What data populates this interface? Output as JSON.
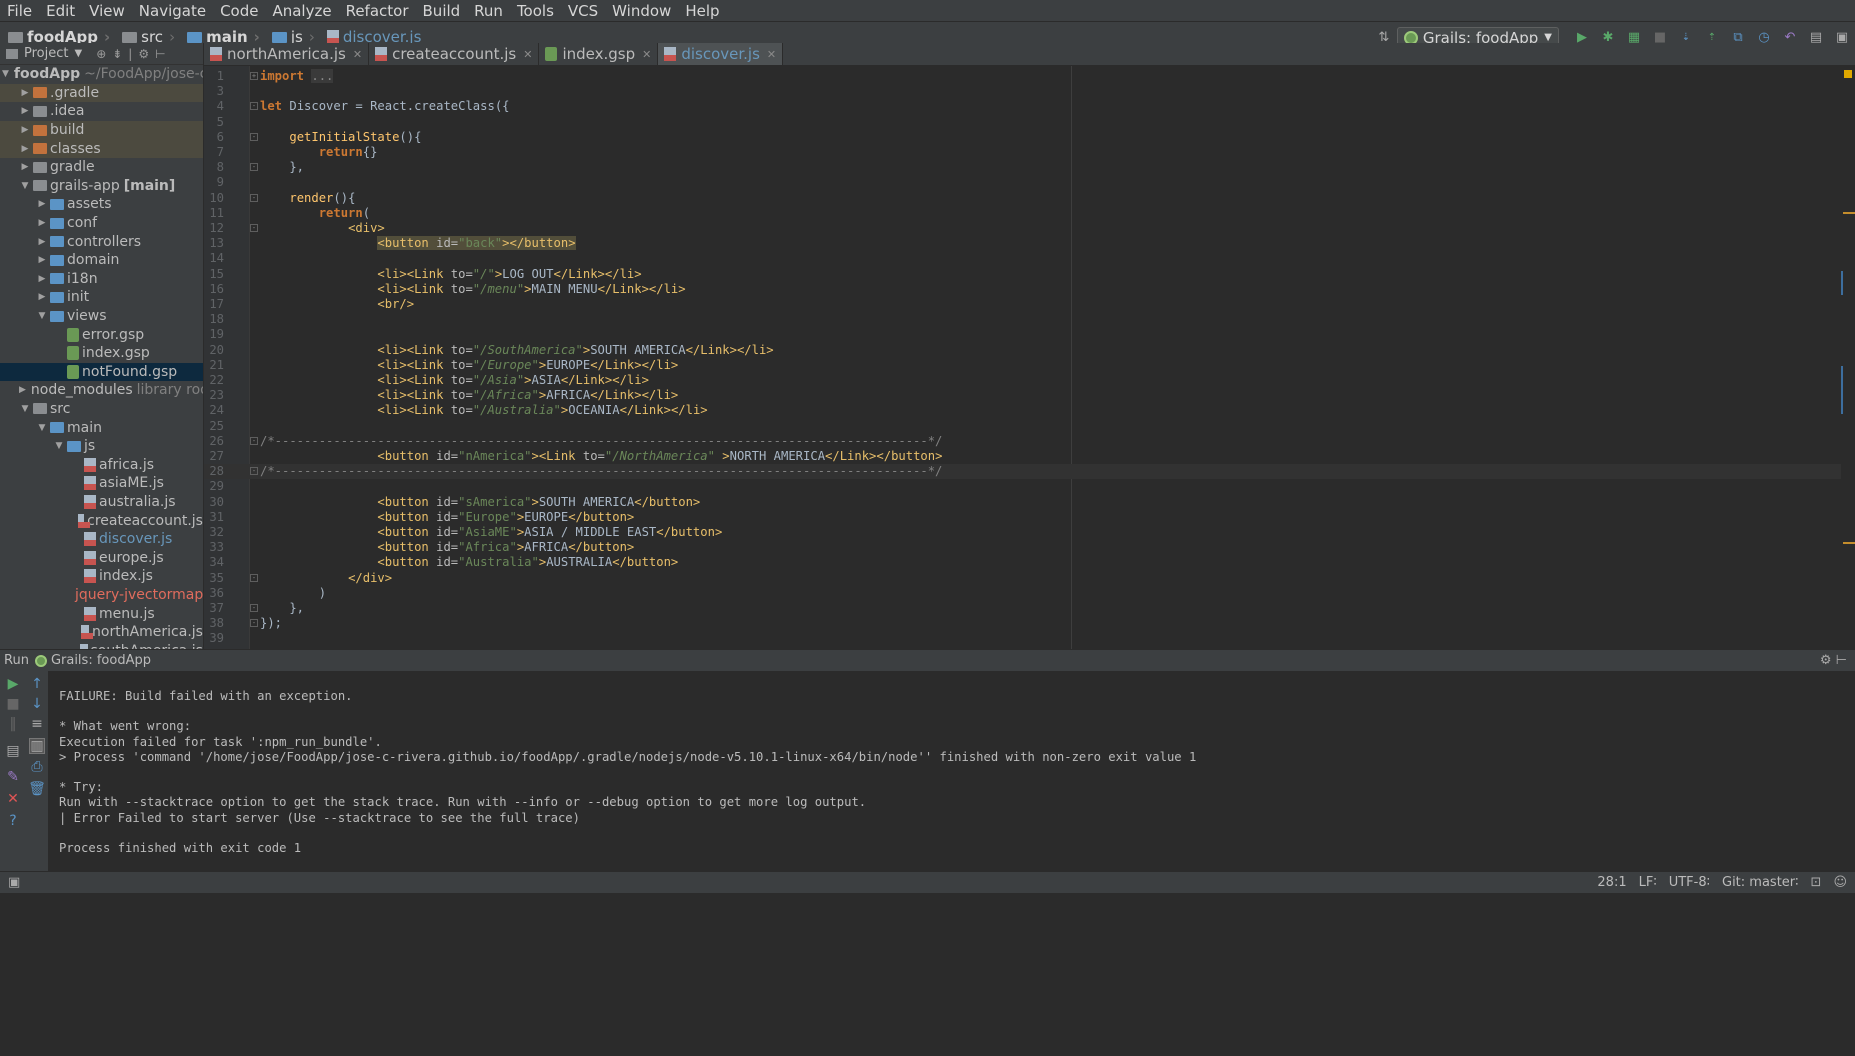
{
  "menu": [
    "File",
    "Edit",
    "View",
    "Navigate",
    "Code",
    "Analyze",
    "Refactor",
    "Build",
    "Run",
    "Tools",
    "VCS",
    "Window",
    "Help"
  ],
  "breadcrumbs": [
    "foodApp",
    "src",
    "main",
    "js",
    "discover.js"
  ],
  "run_config": "Grails: foodApp",
  "project_panel": {
    "title": "Project",
    "tree": [
      {
        "label": "foodApp",
        "extra": "~/FoodApp/jose-c-r",
        "level": 0,
        "type": "folder-gray",
        "expanded": true,
        "bold": true
      },
      {
        "label": ".gradle",
        "level": 1,
        "type": "folder-orange",
        "expanded": false,
        "excluded": true
      },
      {
        "label": ".idea",
        "level": 1,
        "type": "folder-gray",
        "expanded": false
      },
      {
        "label": "build",
        "level": 1,
        "type": "folder-orange",
        "expanded": false,
        "excluded": true
      },
      {
        "label": "classes",
        "level": 1,
        "type": "folder-orange",
        "expanded": false,
        "excluded": true
      },
      {
        "label": "gradle",
        "level": 1,
        "type": "folder-gray",
        "expanded": false
      },
      {
        "label": "grails-app",
        "extra": "[main]",
        "level": 1,
        "type": "folder-gray",
        "expanded": true
      },
      {
        "label": "assets",
        "level": 2,
        "type": "folder-blue",
        "expanded": false
      },
      {
        "label": "conf",
        "level": 2,
        "type": "folder-blue",
        "expanded": false
      },
      {
        "label": "controllers",
        "level": 2,
        "type": "folder-blue",
        "expanded": false
      },
      {
        "label": "domain",
        "level": 2,
        "type": "folder-blue",
        "expanded": false
      },
      {
        "label": "i18n",
        "level": 2,
        "type": "folder-blue",
        "expanded": false
      },
      {
        "label": "init",
        "level": 2,
        "type": "folder-blue",
        "expanded": false
      },
      {
        "label": "views",
        "level": 2,
        "type": "folder-blue",
        "expanded": true
      },
      {
        "label": "error.gsp",
        "level": 3,
        "type": "gsp"
      },
      {
        "label": "index.gsp",
        "level": 3,
        "type": "gsp"
      },
      {
        "label": "notFound.gsp",
        "level": 3,
        "type": "gsp",
        "selected": true
      },
      {
        "label": "node_modules",
        "extra": "library roo",
        "level": 1,
        "type": "folder-gray",
        "expanded": false
      },
      {
        "label": "src",
        "level": 1,
        "type": "folder-gray",
        "expanded": true
      },
      {
        "label": "main",
        "level": 2,
        "type": "folder-blue",
        "expanded": true
      },
      {
        "label": "js",
        "level": 3,
        "type": "folder-blue",
        "expanded": true
      },
      {
        "label": "africa.js",
        "level": 4,
        "type": "js"
      },
      {
        "label": "asiaME.js",
        "level": 4,
        "type": "js"
      },
      {
        "label": "australia.js",
        "level": 4,
        "type": "js"
      },
      {
        "label": "createaccount.js",
        "level": 4,
        "type": "js"
      },
      {
        "label": "discover.js",
        "level": 4,
        "type": "js",
        "color": "blue"
      },
      {
        "label": "europe.js",
        "level": 4,
        "type": "js"
      },
      {
        "label": "index.js",
        "level": 4,
        "type": "js"
      },
      {
        "label": "jquery-jvectormap",
        "level": 4,
        "type": "bin",
        "color": "red"
      },
      {
        "label": "menu.js",
        "level": 4,
        "type": "js"
      },
      {
        "label": "northAmerica.js",
        "level": 4,
        "type": "js"
      },
      {
        "label": "southAmerica.js",
        "level": 4,
        "type": "js"
      }
    ]
  },
  "tabs": [
    {
      "label": "northAmerica.js",
      "type": "js",
      "active": false
    },
    {
      "label": "createaccount.js",
      "type": "js",
      "active": false
    },
    {
      "label": "index.gsp",
      "type": "gsp",
      "active": false
    },
    {
      "label": "discover.js",
      "type": "js",
      "active": true
    }
  ],
  "editor": {
    "lines": [
      {
        "n": "1",
        "fold": "+",
        "tokens": [
          [
            "kw",
            "import"
          ],
          [
            "ident",
            " "
          ],
          [
            "fold-box",
            "..."
          ]
        ]
      },
      {
        "n": "3",
        "tokens": []
      },
      {
        "n": "4",
        "fold": "-",
        "tokens": [
          [
            "kw",
            "let"
          ],
          [
            "ident",
            " Discover = React."
          ],
          [
            "fn2",
            "createClass"
          ],
          [
            "ident",
            "({"
          ]
        ]
      },
      {
        "n": "5",
        "tokens": []
      },
      {
        "n": "6",
        "fold": "-",
        "tokens": [
          [
            "ident",
            "    "
          ],
          [
            "fn",
            "getInitialState"
          ],
          [
            "ident",
            "(){"
          ]
        ]
      },
      {
        "n": "7",
        "tokens": [
          [
            "ident",
            "        "
          ],
          [
            "kw",
            "return"
          ],
          [
            "ident",
            "{}"
          ]
        ]
      },
      {
        "n": "8",
        "fold": "-",
        "tokens": [
          [
            "ident",
            "    },"
          ]
        ]
      },
      {
        "n": "9",
        "tokens": []
      },
      {
        "n": "10",
        "fold": "-",
        "tokens": [
          [
            "ident",
            "    "
          ],
          [
            "fn",
            "render"
          ],
          [
            "ident",
            "(){"
          ]
        ]
      },
      {
        "n": "11",
        "tokens": [
          [
            "ident",
            "        "
          ],
          [
            "kw",
            "return"
          ],
          [
            "ident",
            "("
          ]
        ]
      },
      {
        "n": "12",
        "fold": "-",
        "tokens": [
          [
            "ident",
            "            "
          ],
          [
            "tag",
            "<div>"
          ]
        ]
      },
      {
        "n": "13",
        "tokens": [
          [
            "ident",
            "                "
          ],
          [
            "hl-tag",
            "<button "
          ],
          [
            "hl-attr",
            "id="
          ],
          [
            "hl-str",
            "\"back\""
          ],
          [
            "hl-tag",
            "></button>"
          ]
        ]
      },
      {
        "n": "14",
        "tokens": []
      },
      {
        "n": "15",
        "tokens": [
          [
            "ident",
            "                "
          ],
          [
            "tag",
            "<li><Link "
          ],
          [
            "attr",
            "to="
          ],
          [
            "str",
            "\"/\""
          ],
          [
            "tag",
            ">"
          ],
          [
            "ident",
            "LOG OUT"
          ],
          [
            "tag",
            "</Link></li>"
          ]
        ]
      },
      {
        "n": "16",
        "tokens": [
          [
            "ident",
            "                "
          ],
          [
            "tag",
            "<li><Link "
          ],
          [
            "attr",
            "to="
          ],
          [
            "str",
            "\"/menu\""
          ],
          [
            "tag",
            ">"
          ],
          [
            "ident",
            "MAIN MENU"
          ],
          [
            "tag",
            "</Link></li>"
          ]
        ]
      },
      {
        "n": "17",
        "tokens": [
          [
            "ident",
            "                "
          ],
          [
            "tag",
            "<br/>"
          ]
        ]
      },
      {
        "n": "18",
        "tokens": []
      },
      {
        "n": "19",
        "tokens": []
      },
      {
        "n": "20",
        "tokens": [
          [
            "ident",
            "                "
          ],
          [
            "tag",
            "<li><Link "
          ],
          [
            "attr",
            "to="
          ],
          [
            "str",
            "\"/SouthAmerica\""
          ],
          [
            "tag",
            ">"
          ],
          [
            "ident",
            "SOUTH AMERICA"
          ],
          [
            "tag",
            "</Link></li>"
          ]
        ]
      },
      {
        "n": "21",
        "tokens": [
          [
            "ident",
            "                "
          ],
          [
            "tag",
            "<li><Link "
          ],
          [
            "attr",
            "to="
          ],
          [
            "str",
            "\"/Europe\""
          ],
          [
            "tag",
            ">"
          ],
          [
            "ident",
            "EUROPE"
          ],
          [
            "tag",
            "</Link></li>"
          ]
        ]
      },
      {
        "n": "22",
        "tokens": [
          [
            "ident",
            "                "
          ],
          [
            "tag",
            "<li><Link "
          ],
          [
            "attr",
            "to="
          ],
          [
            "str",
            "\"/Asia\""
          ],
          [
            "tag",
            ">"
          ],
          [
            "ident",
            "ASIA"
          ],
          [
            "tag",
            "</Link></li>"
          ]
        ]
      },
      {
        "n": "23",
        "tokens": [
          [
            "ident",
            "                "
          ],
          [
            "tag",
            "<li><Link "
          ],
          [
            "attr",
            "to="
          ],
          [
            "str",
            "\"/Africa\""
          ],
          [
            "tag",
            ">"
          ],
          [
            "ident",
            "AFRICA"
          ],
          [
            "tag",
            "</Link></li>"
          ]
        ]
      },
      {
        "n": "24",
        "tokens": [
          [
            "ident",
            "                "
          ],
          [
            "tag",
            "<li><Link "
          ],
          [
            "attr",
            "to="
          ],
          [
            "str",
            "\"/Australia\""
          ],
          [
            "tag",
            ">"
          ],
          [
            "ident",
            "OCEANIA"
          ],
          [
            "tag",
            "</Link></li>"
          ]
        ]
      },
      {
        "n": "25",
        "tokens": []
      },
      {
        "n": "26",
        "fold": "-",
        "tokens": [
          [
            "cm",
            "/*-----------------------------------------------------------------------------------------*/"
          ]
        ]
      },
      {
        "n": "27",
        "tokens": [
          [
            "ident",
            "                "
          ],
          [
            "tag",
            "<button "
          ],
          [
            "attr",
            "id="
          ],
          [
            "str",
            "\"nAmerica\""
          ],
          [
            "tag",
            "><Link "
          ],
          [
            "attr",
            "to="
          ],
          [
            "str",
            "\"/NorthAmerica\" "
          ],
          [
            "tag",
            ">"
          ],
          [
            "ident",
            "NORTH AMERICA"
          ],
          [
            "tag",
            "</Link></button>"
          ]
        ]
      },
      {
        "n": "28",
        "fold": "-",
        "current": true,
        "tokens": [
          [
            "cm",
            "/*-----------------------------------------------------------------------------------------*/"
          ]
        ]
      },
      {
        "n": "29",
        "tokens": []
      },
      {
        "n": "30",
        "tokens": [
          [
            "ident",
            "                "
          ],
          [
            "tag",
            "<button "
          ],
          [
            "attr",
            "id="
          ],
          [
            "str",
            "\"sAmerica\""
          ],
          [
            "tag",
            ">"
          ],
          [
            "ident",
            "SOUTH AMERICA"
          ],
          [
            "tag",
            "</button>"
          ]
        ]
      },
      {
        "n": "31",
        "tokens": [
          [
            "ident",
            "                "
          ],
          [
            "tag",
            "<button "
          ],
          [
            "attr",
            "id="
          ],
          [
            "str",
            "\"Europe\""
          ],
          [
            "tag",
            ">"
          ],
          [
            "ident",
            "EUROPE"
          ],
          [
            "tag",
            "</button>"
          ]
        ]
      },
      {
        "n": "32",
        "tokens": [
          [
            "ident",
            "                "
          ],
          [
            "tag",
            "<button "
          ],
          [
            "attr",
            "id="
          ],
          [
            "str",
            "\"AsiaME\""
          ],
          [
            "tag",
            ">"
          ],
          [
            "ident",
            "ASIA / MIDDLE EAST"
          ],
          [
            "tag",
            "</button>"
          ]
        ]
      },
      {
        "n": "33",
        "tokens": [
          [
            "ident",
            "                "
          ],
          [
            "tag",
            "<button "
          ],
          [
            "attr",
            "id="
          ],
          [
            "str",
            "\"Africa\""
          ],
          [
            "tag",
            ">"
          ],
          [
            "ident",
            "AFRICA"
          ],
          [
            "tag",
            "</button>"
          ]
        ]
      },
      {
        "n": "34",
        "tokens": [
          [
            "ident",
            "                "
          ],
          [
            "tag",
            "<button "
          ],
          [
            "attr",
            "id="
          ],
          [
            "str",
            "\"Australia\""
          ],
          [
            "tag",
            ">"
          ],
          [
            "ident",
            "AUSTRALIA"
          ],
          [
            "tag",
            "</button>"
          ]
        ]
      },
      {
        "n": "35",
        "fold": "-",
        "tokens": [
          [
            "ident",
            "            "
          ],
          [
            "tag",
            "</div>"
          ]
        ]
      },
      {
        "n": "36",
        "tokens": [
          [
            "ident",
            "        )"
          ]
        ]
      },
      {
        "n": "37",
        "fold": "-",
        "tokens": [
          [
            "ident",
            "    },"
          ]
        ]
      },
      {
        "n": "38",
        "fold": "-",
        "tokens": [
          [
            "ident",
            "});"
          ]
        ]
      },
      {
        "n": "39",
        "tokens": []
      }
    ]
  },
  "run_panel": {
    "label": "Run",
    "config": "Grails: foodApp",
    "console": [
      "FAILURE: Build failed with an exception.",
      "",
      "* What went wrong:",
      "Execution failed for task ':npm_run_bundle'.",
      "> Process 'command '/home/jose/FoodApp/jose-c-rivera.github.io/foodApp/.gradle/nodejs/node-v5.10.1-linux-x64/bin/node'' finished with non-zero exit value 1",
      "",
      "* Try:",
      "Run with --stacktrace option to get the stack trace. Run with --info or --debug option to get more log output.",
      "| Error Failed to start server (Use --stacktrace to see the full trace)",
      "",
      "Process finished with exit code 1"
    ]
  },
  "status_bar": {
    "position": "28:1",
    "line_sep": "LF∶",
    "encoding": "UTF-8∶",
    "git": "Git: master∶"
  }
}
